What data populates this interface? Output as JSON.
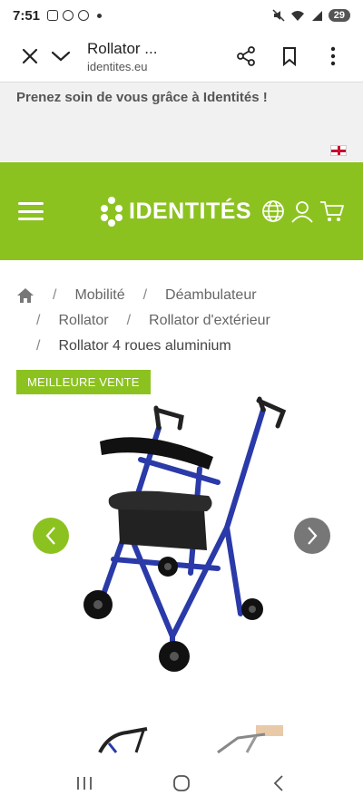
{
  "status": {
    "time": "7:51",
    "battery": "29"
  },
  "browser": {
    "title": "Rollator ...",
    "url": "identites.eu",
    "icons": [
      "close-icon",
      "chevron-down-icon",
      "share-icon",
      "bookmark-icon",
      "more-vert-icon"
    ]
  },
  "promo": {
    "text": "Prenez soin de vous grâce à Identités !",
    "language_flag": "uk-flag"
  },
  "header": {
    "logo_text": "IDENTITÉS",
    "brand_color": "#8cc220",
    "icons": [
      "menu-icon",
      "globe-icon",
      "user-icon",
      "cart-icon"
    ]
  },
  "breadcrumb": {
    "home_icon": "home-icon",
    "items": [
      "Mobilité",
      "Déambulateur",
      "Rollator",
      "Rollator d'extérieur",
      "Rollator 4 roues aluminium"
    ],
    "separator": "/"
  },
  "product": {
    "badge": "MEILLEURE VENTE",
    "image": "blue four-wheel aluminium rollator with black seat and basket"
  },
  "nav": {
    "icons": [
      "recent-apps-icon",
      "home-nav-icon",
      "back-icon"
    ]
  }
}
